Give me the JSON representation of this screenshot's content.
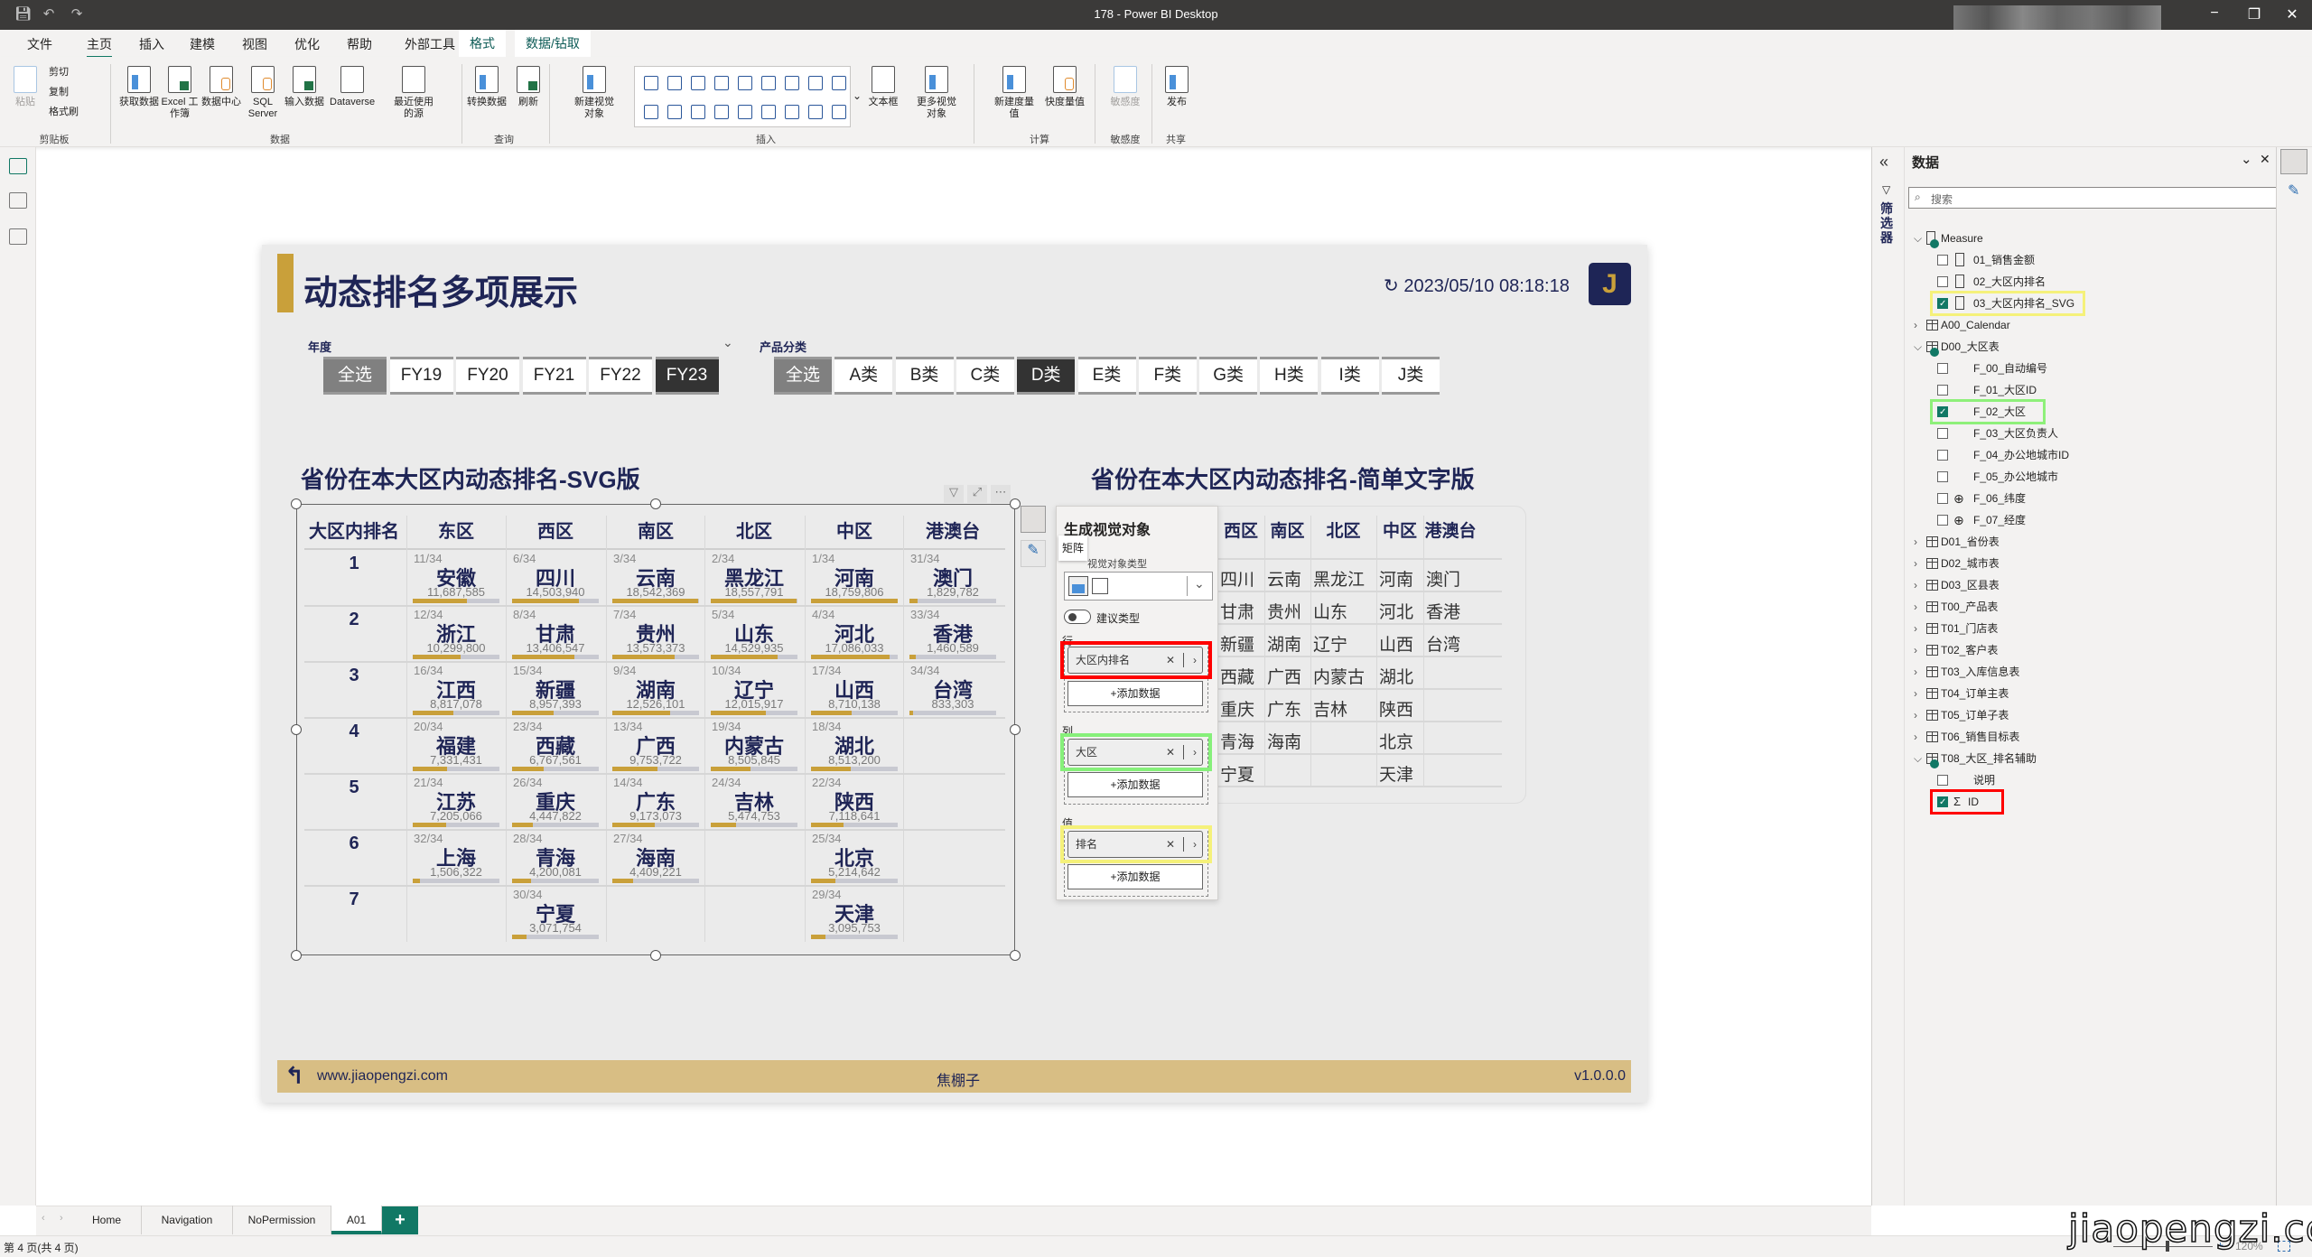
{
  "window": {
    "title": "178 - Power BI Desktop",
    "controls": [
      "−",
      "❐",
      "✕"
    ]
  },
  "menu": {
    "tabs": [
      "文件",
      "主页",
      "插入",
      "建模",
      "视图",
      "优化",
      "帮助",
      "外部工具",
      "格式",
      "数据/钻取"
    ],
    "active": "主页"
  },
  "ribbon": {
    "buttons": [
      "粘贴",
      "获取数据",
      "Excel 工作簿",
      "数据中心",
      "SQL Server",
      "输入数据",
      "Dataverse",
      "最近使用的源",
      "转换数据",
      "刷新",
      "新建视觉对象",
      "文本框",
      "更多视觉对象",
      "新建度量值",
      "快度量值",
      "敏感度",
      "发布"
    ],
    "clipboard": [
      "剪切",
      "复制",
      "格式刷"
    ],
    "groups": [
      "剪贴板",
      "数据",
      "查询",
      "插入",
      "计算",
      "敏感度",
      "共享"
    ]
  },
  "report": {
    "title": "动态排名多项展示",
    "refresh_time": "2023/05/10 08:18:18",
    "logo_letter": "J",
    "year_slicer": {
      "label": "年度",
      "options": [
        "全选",
        "FY19",
        "FY20",
        "FY21",
        "FY22",
        "FY23"
      ],
      "selected": "FY23"
    },
    "category_slicer": {
      "label": "产品分类",
      "options": [
        "全选",
        "A类",
        "B类",
        "C类",
        "D类",
        "E类",
        "F类",
        "G类",
        "H类",
        "I类",
        "J类"
      ],
      "selected": "D类"
    },
    "svg_title": "省份在本大区内动态排名-SVG版",
    "text_title": "省份在本大区内动态排名-简单文字版",
    "row_header": "大区内排名",
    "rows": [
      "1",
      "2",
      "3",
      "4",
      "5",
      "6",
      "7"
    ],
    "regions": [
      "东区",
      "西区",
      "南区",
      "北区",
      "中区",
      "港澳台"
    ],
    "cells": [
      [
        {
          "rank": "11/34",
          "name": "安徽",
          "value": "11,687,585"
        },
        {
          "rank": "12/34",
          "name": "浙江",
          "value": "10,299,800"
        },
        {
          "rank": "16/34",
          "name": "江西",
          "value": "8,817,078"
        },
        {
          "rank": "20/34",
          "name": "福建",
          "value": "7,331,431"
        },
        {
          "rank": "21/34",
          "name": "江苏",
          "value": "7,205,066"
        },
        {
          "rank": "32/34",
          "name": "上海",
          "value": "1,506,322"
        },
        null
      ],
      [
        {
          "rank": "6/34",
          "name": "四川",
          "value": "14,503,940"
        },
        {
          "rank": "8/34",
          "name": "甘肃",
          "value": "13,406,547"
        },
        {
          "rank": "15/34",
          "name": "新疆",
          "value": "8,957,393"
        },
        {
          "rank": "23/34",
          "name": "西藏",
          "value": "6,767,561"
        },
        {
          "rank": "26/34",
          "name": "重庆",
          "value": "4,447,822"
        },
        {
          "rank": "28/34",
          "name": "青海",
          "value": "4,200,081"
        },
        {
          "rank": "30/34",
          "name": "宁夏",
          "value": "3,071,754"
        }
      ],
      [
        {
          "rank": "3/34",
          "name": "云南",
          "value": "18,542,369"
        },
        {
          "rank": "7/34",
          "name": "贵州",
          "value": "13,573,373"
        },
        {
          "rank": "9/34",
          "name": "湖南",
          "value": "12,526,101"
        },
        {
          "rank": "13/34",
          "name": "广西",
          "value": "9,753,722"
        },
        {
          "rank": "14/34",
          "name": "广东",
          "value": "9,173,073"
        },
        {
          "rank": "27/34",
          "name": "海南",
          "value": "4,409,221"
        },
        null
      ],
      [
        {
          "rank": "2/34",
          "name": "黑龙江",
          "value": "18,557,791"
        },
        {
          "rank": "5/34",
          "name": "山东",
          "value": "14,529,935"
        },
        {
          "rank": "10/34",
          "name": "辽宁",
          "value": "12,015,917"
        },
        {
          "rank": "19/34",
          "name": "内蒙古",
          "value": "8,505,845"
        },
        {
          "rank": "24/34",
          "name": "吉林",
          "value": "5,474,753"
        },
        null,
        null
      ],
      [
        {
          "rank": "1/34",
          "name": "河南",
          "value": "18,759,806"
        },
        {
          "rank": "4/34",
          "name": "河北",
          "value": "17,086,033"
        },
        {
          "rank": "17/34",
          "name": "山西",
          "value": "8,710,138"
        },
        {
          "rank": "18/34",
          "name": "湖北",
          "value": "8,513,200"
        },
        {
          "rank": "22/34",
          "name": "陕西",
          "value": "7,118,641"
        },
        {
          "rank": "25/34",
          "name": "北京",
          "value": "5,214,642"
        },
        {
          "rank": "29/34",
          "name": "天津",
          "value": "3,095,753"
        }
      ],
      [
        {
          "rank": "31/34",
          "name": "澳门",
          "value": "1,829,782"
        },
        {
          "rank": "33/34",
          "name": "香港",
          "value": "1,460,589"
        },
        {
          "rank": "34/34",
          "name": "台湾",
          "value": "833,303"
        },
        null,
        null,
        null,
        null
      ]
    ],
    "footer": {
      "url": "www.jiaopengzi.com",
      "author": "焦棚子",
      "version": "v1.0.0.0"
    },
    "colors": {
      "navy": "#1f2556",
      "gold": "#c9a03a",
      "footer": "#d8be84"
    }
  },
  "build_panel": {
    "title": "生成视觉对象",
    "tooltip": "矩阵",
    "type_label": "视觉对象类型",
    "suggest_toggle": "建议类型",
    "rows_label": "行",
    "rows_field": "大区内排名",
    "cols_label": "列",
    "cols_field": "大区",
    "values_label": "值",
    "values_field": "排名",
    "add_data": "+添加数据"
  },
  "filters_pane": {
    "label": "筛选器"
  },
  "data_pane": {
    "title": "数据",
    "search_placeholder": "搜索",
    "items": [
      {
        "label": "Measure",
        "level": 0,
        "kind": "measure-table",
        "expanded": true
      },
      {
        "label": "01_销售金额",
        "level": 1,
        "kind": "measure",
        "checked": false
      },
      {
        "label": "02_大区内排名",
        "level": 1,
        "kind": "measure",
        "checked": false
      },
      {
        "label": "03_大区内排名_SVG",
        "level": 1,
        "kind": "measure",
        "checked": true,
        "highlight": "#f5f17a"
      },
      {
        "label": "A00_Calendar",
        "level": 0,
        "kind": "table",
        "expanded": false
      },
      {
        "label": "D00_大区表",
        "level": 0,
        "kind": "table-used",
        "expanded": true
      },
      {
        "label": "F_00_自动编号",
        "level": 1,
        "kind": "field",
        "checked": false
      },
      {
        "label": "F_01_大区ID",
        "level": 1,
        "kind": "field",
        "checked": false
      },
      {
        "label": "F_02_大区",
        "level": 1,
        "kind": "field",
        "checked": true,
        "highlight": "#8ef07a"
      },
      {
        "label": "F_03_大区负责人",
        "level": 1,
        "kind": "field",
        "checked": false
      },
      {
        "label": "F_04_办公地城市ID",
        "level": 1,
        "kind": "field",
        "checked": false
      },
      {
        "label": "F_05_办公地城市",
        "level": 1,
        "kind": "field",
        "checked": false
      },
      {
        "label": "F_06_纬度",
        "level": 1,
        "kind": "globe",
        "checked": false
      },
      {
        "label": "F_07_经度",
        "level": 1,
        "kind": "globe",
        "checked": false
      },
      {
        "label": "D01_省份表",
        "level": 0,
        "kind": "table",
        "expanded": false
      },
      {
        "label": "D02_城市表",
        "level": 0,
        "kind": "table",
        "expanded": false
      },
      {
        "label": "D03_区县表",
        "level": 0,
        "kind": "table",
        "expanded": false
      },
      {
        "label": "T00_产品表",
        "level": 0,
        "kind": "table",
        "expanded": false
      },
      {
        "label": "T01_门店表",
        "level": 0,
        "kind": "table",
        "expanded": false
      },
      {
        "label": "T02_客户表",
        "level": 0,
        "kind": "table",
        "expanded": false
      },
      {
        "label": "T03_入库信息表",
        "level": 0,
        "kind": "table",
        "expanded": false
      },
      {
        "label": "T04_订单主表",
        "level": 0,
        "kind": "table",
        "expanded": false
      },
      {
        "label": "T05_订单子表",
        "level": 0,
        "kind": "table",
        "expanded": false
      },
      {
        "label": "T06_销售目标表",
        "level": 0,
        "kind": "table",
        "expanded": false
      },
      {
        "label": "T08_大区_排名辅助",
        "level": 0,
        "kind": "table-used",
        "expanded": true
      },
      {
        "label": "说明",
        "level": 1,
        "kind": "field",
        "checked": false
      },
      {
        "label": "ID",
        "level": 1,
        "kind": "sum",
        "checked": true,
        "highlight": "#ff0000"
      }
    ]
  },
  "page_tabs": {
    "tabs": [
      "Home",
      "Navigation",
      "NoPermission",
      "A01"
    ],
    "active": "A01",
    "add": "+"
  },
  "status": {
    "page_info": "第 4 页(共 4 页)",
    "zoom": "120%",
    "watermark": "jiaopengzi.com"
  }
}
